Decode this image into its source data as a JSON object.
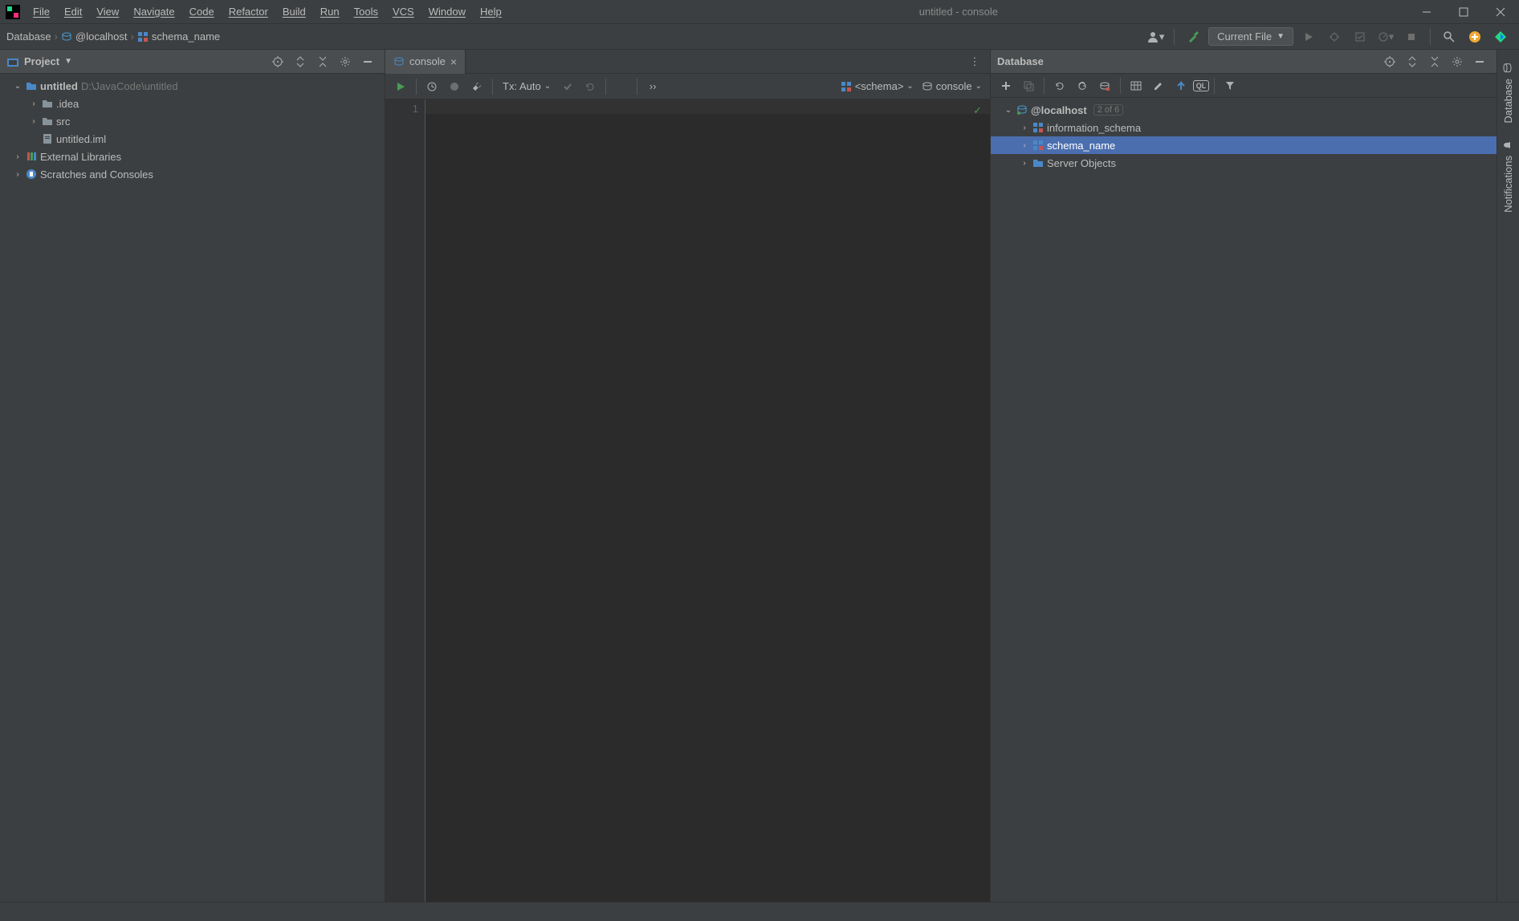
{
  "title": "untitled - console",
  "menus": [
    "File",
    "Edit",
    "View",
    "Navigate",
    "Code",
    "Refactor",
    "Build",
    "Run",
    "Tools",
    "VCS",
    "Window",
    "Help"
  ],
  "breadcrumb": {
    "item1": "Database",
    "item2": "@localhost",
    "item3": "schema_name"
  },
  "runconfig": "Current File",
  "project_panel": {
    "title": "Project",
    "root": {
      "name": "untitled",
      "path": "D:\\JavaCode\\untitled"
    },
    "idea": ".idea",
    "src": "src",
    "iml": "untitled.iml",
    "ext": "External Libraries",
    "scratch": "Scratches and Consoles"
  },
  "editor": {
    "tab": "console",
    "tx": "Tx: Auto",
    "schema": "<schema>",
    "console_combo": "console",
    "line1": "1"
  },
  "db_panel": {
    "title": "Database",
    "root": "@localhost",
    "root_hint": "2 of 6",
    "info_schema": "information_schema",
    "schema_name": "schema_name",
    "server_objects": "Server Objects"
  },
  "rail": {
    "db": "Database",
    "notif": "Notifications"
  }
}
